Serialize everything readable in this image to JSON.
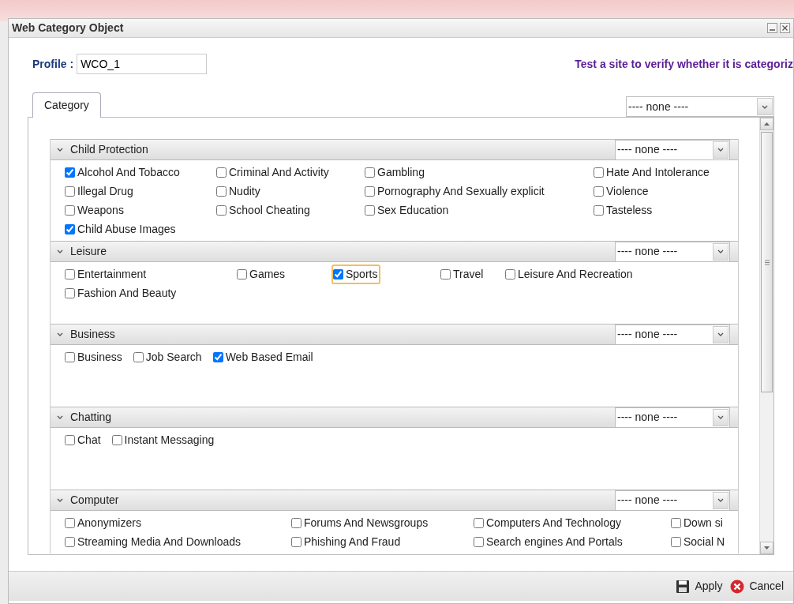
{
  "window": {
    "title": "Web Category Object"
  },
  "profile": {
    "label": "Profile :",
    "value": "WCO_1"
  },
  "test_link": "Test a site to verify whether it is categoriz",
  "tabs": [
    {
      "label": "Category",
      "selected": true
    }
  ],
  "global_select": {
    "value": "---- none ----"
  },
  "sections": [
    {
      "title": "Child Protection",
      "expanded": true,
      "select": "---- none ----",
      "items": [
        {
          "label": "Alcohol And Tobacco",
          "checked": true,
          "focused": false
        },
        {
          "label": "Criminal And Activity",
          "checked": false,
          "focused": false
        },
        {
          "label": "Gambling",
          "checked": false,
          "focused": false
        },
        {
          "label": "Hate And Intolerance",
          "checked": false,
          "focused": false
        },
        {
          "label": "Illegal Drug",
          "checked": false,
          "focused": false
        },
        {
          "label": "Nudity",
          "checked": false,
          "focused": false
        },
        {
          "label": "Pornography And Sexually explicit",
          "checked": false,
          "focused": false
        },
        {
          "label": "Violence",
          "checked": false,
          "focused": false
        },
        {
          "label": "Weapons",
          "checked": false,
          "focused": false
        },
        {
          "label": "School Cheating",
          "checked": false,
          "focused": false
        },
        {
          "label": "Sex Education",
          "checked": false,
          "focused": false
        },
        {
          "label": "Tasteless",
          "checked": false,
          "focused": false
        },
        {
          "label": "Child Abuse Images",
          "checked": true,
          "focused": false
        }
      ]
    },
    {
      "title": "Leisure",
      "expanded": true,
      "select": "---- none ----",
      "items": [
        {
          "label": "Entertainment",
          "checked": false,
          "focused": false
        },
        {
          "label": "Games",
          "checked": false,
          "focused": false
        },
        {
          "label": "Sports",
          "checked": true,
          "focused": true
        },
        {
          "label": "Travel",
          "checked": false,
          "focused": false
        },
        {
          "label": "Leisure And Recreation",
          "checked": false,
          "focused": false
        },
        {
          "label": "Fashion And Beauty",
          "checked": false,
          "focused": false
        }
      ]
    },
    {
      "title": "Business",
      "expanded": true,
      "select": "---- none ----",
      "items": [
        {
          "label": "Business",
          "checked": false,
          "focused": false
        },
        {
          "label": "Job Search",
          "checked": false,
          "focused": false
        },
        {
          "label": "Web Based Email",
          "checked": true,
          "focused": false
        }
      ]
    },
    {
      "title": "Chatting",
      "expanded": true,
      "select": "---- none ----",
      "items": [
        {
          "label": "Chat",
          "checked": false,
          "focused": false
        },
        {
          "label": "Instant Messaging",
          "checked": false,
          "focused": false
        }
      ]
    },
    {
      "title": "Computer",
      "expanded": true,
      "select": "---- none ----",
      "items": [
        {
          "label": "Anonymizers",
          "checked": false,
          "focused": false
        },
        {
          "label": "Forums And Newsgroups",
          "checked": false,
          "focused": false
        },
        {
          "label": "Computers And Technology",
          "checked": false,
          "focused": false
        },
        {
          "label": "Down si",
          "checked": false,
          "focused": false
        },
        {
          "label": "Streaming Media And Downloads",
          "checked": false,
          "focused": false
        },
        {
          "label": "Phishing And Fraud",
          "checked": false,
          "focused": false
        },
        {
          "label": "Search engines And Portals",
          "checked": false,
          "focused": false
        },
        {
          "label": "Social N",
          "checked": false,
          "focused": false
        }
      ]
    }
  ],
  "footer": {
    "buttons": [
      {
        "label": "Apply",
        "kind": "save"
      },
      {
        "label": "Cancel",
        "kind": "cancel"
      }
    ]
  }
}
